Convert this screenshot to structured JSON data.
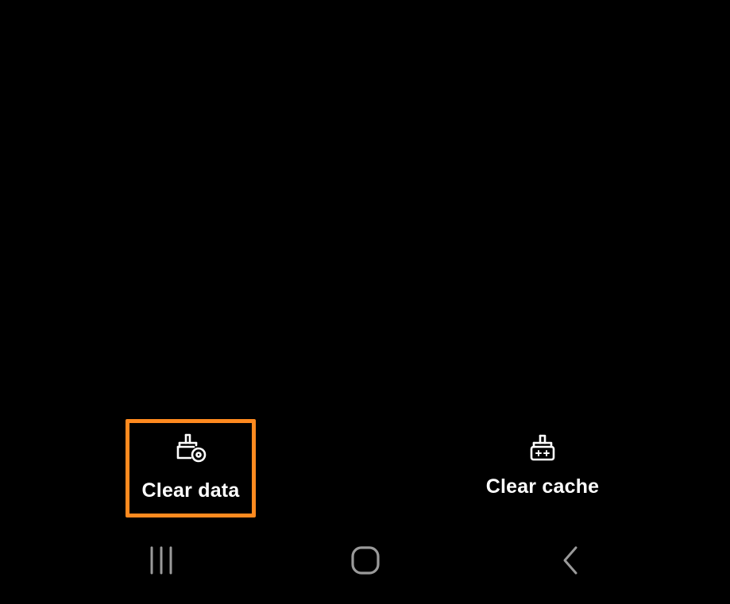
{
  "actions": {
    "clear_data": {
      "label": "Clear data",
      "icon": "clear-data-icon",
      "highlighted": true
    },
    "clear_cache": {
      "label": "Clear cache",
      "icon": "clear-cache-icon"
    }
  },
  "navigation": {
    "recents_icon": "recents-icon",
    "home_icon": "home-icon",
    "back_icon": "back-icon"
  },
  "colors": {
    "background": "#000000",
    "text": "#ffffff",
    "highlight": "#ff8a1f",
    "nav_icon": "#9a9a9a"
  }
}
